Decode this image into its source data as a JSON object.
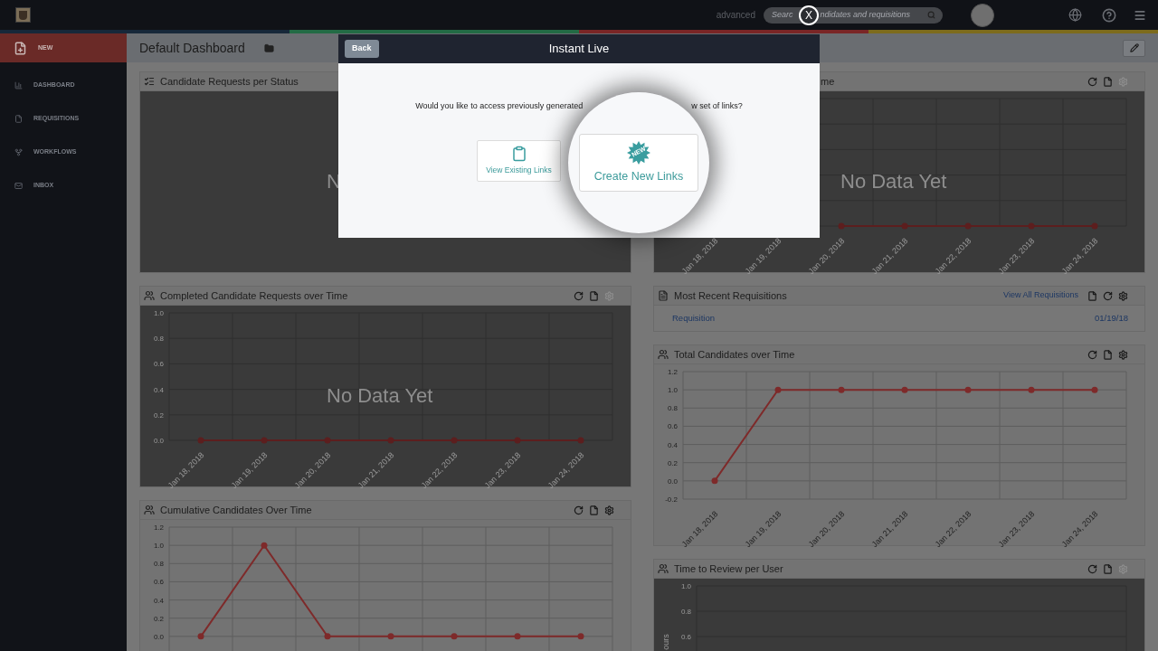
{
  "topbar": {
    "mode_link": "advanced",
    "search": {
      "hint_parts": [
        "Searc",
        "ndidates and requisitions"
      ]
    },
    "close_label": "X"
  },
  "sidebar": {
    "items": [
      {
        "label": "NEW",
        "selected": true
      },
      {
        "label": "DASHBOARD",
        "selected": false
      },
      {
        "label": "REQUISITIONS",
        "selected": false
      },
      {
        "label": "WORKFLOWS",
        "selected": false
      },
      {
        "label": "INBOX",
        "selected": false
      }
    ]
  },
  "dashboard": {
    "title": "Default Dashboard"
  },
  "columns": [
    [
      {
        "kind": "chart",
        "title": "Candidate Requests per Status",
        "empty": true,
        "message": "N"
      },
      {
        "kind": "chart",
        "title": "Completed Candidate Requests over Time",
        "empty": true,
        "message": "No Data Yet",
        "actions": [
          {
            "kind": "refresh",
            "disabled": false
          },
          {
            "kind": "document",
            "disabled": false
          },
          {
            "kind": "settings",
            "disabled": true
          }
        ],
        "chart_data": {
          "type": "line",
          "grid": true,
          "categories": [
            "Jan 18, 2018",
            "Jan 19, 2018",
            "Jan 20, 2018",
            "Jan 21, 2018",
            "Jan 22, 2018",
            "Jan 23, 2018",
            "Jan 24, 2018"
          ],
          "ylim": [
            0,
            1
          ],
          "yticks": [
            {
              "value": 0,
              "label": "0.0"
            },
            {
              "value": 0.2,
              "label": "0.2"
            },
            {
              "value": 0.4,
              "label": "0.4"
            },
            {
              "value": 0.6,
              "label": "0.6"
            },
            {
              "value": 0.8,
              "label": "0.8"
            },
            {
              "value": 1,
              "label": "1.0"
            }
          ],
          "series": [
            {
              "color": "#5c1e1e",
              "marker": "circle",
              "values": [
                0,
                0,
                0,
                0,
                0,
                0,
                0
              ]
            }
          ]
        }
      },
      {
        "kind": "chart",
        "title": "Cumulative Candidates Over Time",
        "empty": false,
        "actions": [
          {
            "kind": "refresh",
            "disabled": false
          },
          {
            "kind": "document",
            "disabled": false
          },
          {
            "kind": "settings",
            "disabled": false
          }
        ],
        "chart_data": {
          "type": "line",
          "grid": true,
          "ylim": [
            -0.2,
            1.2
          ],
          "yticks": [
            {
              "value": 0,
              "label": "0.0"
            },
            {
              "value": 0.2,
              "label": "0.2"
            },
            {
              "value": 0.4,
              "label": "0.4"
            },
            {
              "value": 0.6,
              "label": "0.6"
            },
            {
              "value": 0.8,
              "label": "0.8"
            },
            {
              "value": 1,
              "label": "1.0"
            },
            {
              "value": 1.2,
              "label": "1.2"
            }
          ],
          "series": [
            {
              "color": "#7e2a2a",
              "marker": "circle",
              "values": [
                0,
                1,
                0,
                0,
                0,
                0,
                0
              ]
            }
          ]
        }
      }
    ],
    [
      {
        "kind": "chart",
        "title": "me",
        "empty": true,
        "message": "No Data Yet",
        "actions": [
          {
            "kind": "refresh",
            "disabled": false
          },
          {
            "kind": "document",
            "disabled": false
          },
          {
            "kind": "settings",
            "disabled": true
          }
        ],
        "x_labels": [
          "Jan 18, 2018",
          "Jan 19, 2018",
          "Jan 20, 2018",
          "Jan 21, 2018",
          "Jan 22, 2018",
          "Jan 23, 2018",
          "Jan 24, 2018"
        ]
      },
      {
        "kind": "list",
        "title": "Most Recent Requisitions",
        "link": "View All Requisitions",
        "actions": [
          {
            "kind": "document",
            "disabled": false
          },
          {
            "kind": "refresh",
            "disabled": false
          },
          {
            "kind": "settings",
            "disabled": false
          }
        ],
        "rows": [
          {
            "name": "Requisition",
            "date": "01/19/18"
          }
        ]
      },
      {
        "kind": "chart",
        "title": "Total Candidates over Time",
        "empty": false,
        "actions": [
          {
            "kind": "refresh",
            "disabled": false
          },
          {
            "kind": "document",
            "disabled": false
          },
          {
            "kind": "settings",
            "disabled": false
          }
        ],
        "chart_data": {
          "type": "line",
          "grid": true,
          "categories": [
            "Jan 18, 2018",
            "Jan 19, 2018",
            "Jan 20, 2018",
            "Jan 21, 2018",
            "Jan 22, 2018",
            "Jan 23, 2018",
            "Jan 24, 2018"
          ],
          "ylim": [
            -0.2,
            1.2
          ],
          "yticks": [
            {
              "value": -0.2,
              "label": "-0.2"
            },
            {
              "value": 0,
              "label": "0.0"
            },
            {
              "value": 0.2,
              "label": "0.2"
            },
            {
              "value": 0.4,
              "label": "0.4"
            },
            {
              "value": 0.6,
              "label": "0.6"
            },
            {
              "value": 0.8,
              "label": "0.8"
            },
            {
              "value": 1,
              "label": "1.0"
            },
            {
              "value": 1.2,
              "label": "1.2"
            }
          ],
          "series": [
            {
              "color": "#7e2a2a",
              "marker": "circle",
              "values": [
                0,
                1,
                1,
                1,
                1,
                1,
                1
              ]
            }
          ]
        }
      },
      {
        "kind": "chart",
        "title": "Time to Review per User",
        "empty": true,
        "actions": [
          {
            "kind": "refresh",
            "disabled": false
          },
          {
            "kind": "document",
            "disabled": false
          },
          {
            "kind": "settings",
            "disabled": true
          }
        ],
        "y_labels": [
          "1.0",
          "0.8",
          "0.6"
        ],
        "axis_title": "ours"
      }
    ]
  ],
  "modal": {
    "back": "Back",
    "title": "Instant Live",
    "prompt_parts": [
      "Would you like to access previously generated",
      "w set of links?"
    ],
    "options": [
      {
        "label": "View Existing Links",
        "magnified": false
      },
      {
        "label": "Create New Links",
        "badge": "NEW",
        "magnified": true
      }
    ]
  }
}
